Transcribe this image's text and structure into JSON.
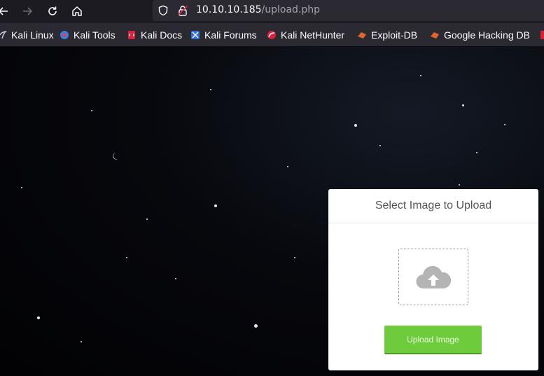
{
  "browser": {
    "url_host": "10.10.10.185",
    "url_path": "/upload.php",
    "bookmarks": [
      {
        "label": "Kali Linux",
        "icon": "kali-dragon-icon"
      },
      {
        "label": "Kali Tools",
        "icon": "kali-tools-icon"
      },
      {
        "label": "Kali Docs",
        "icon": "kali-docs-icon"
      },
      {
        "label": "Kali Forums",
        "icon": "kali-forums-icon"
      },
      {
        "label": "Kali NetHunter",
        "icon": "kali-nethunter-icon"
      },
      {
        "label": "Exploit-DB",
        "icon": "exploit-db-icon"
      },
      {
        "label": "Google Hacking DB",
        "icon": "ghdb-icon"
      }
    ]
  },
  "upload": {
    "title": "Select Image to Upload",
    "button_label": "Upload Image",
    "dropzone_icon": "cloud-upload-icon"
  },
  "colors": {
    "toolbar_bg": "#1c1b22",
    "urlbar_bg": "#2b2a33",
    "button_green": "#6ecb3c",
    "card_bg": "#ffffff"
  }
}
